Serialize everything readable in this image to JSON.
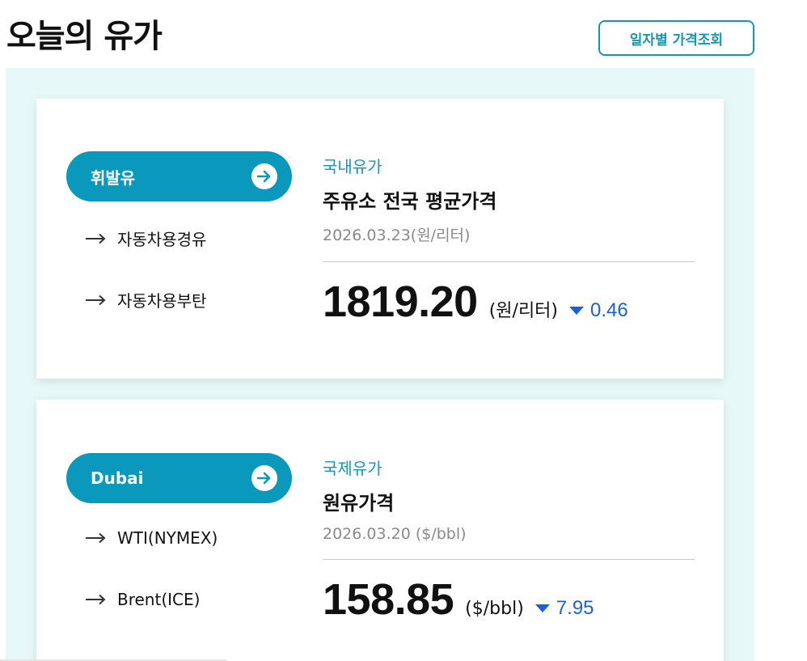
{
  "header": {
    "title": "오늘의 유가",
    "date_button_label": "일자별 가격조회"
  },
  "cards": [
    {
      "pill_label": "휘발유",
      "sub_links": [
        "자동차용경유",
        "자동차용부탄"
      ],
      "category": "국내유가",
      "heading": "주유소 전국 평균가격",
      "date": "2026.03.23(원/리터)",
      "price": "1819.20",
      "unit": "(원/리터)",
      "change": "0.46",
      "change_direction": "down"
    },
    {
      "pill_label": "Dubai",
      "sub_links": [
        "WTI(NYMEX)",
        "Brent(ICE)"
      ],
      "category": "국제유가",
      "heading": "원유가격",
      "date": "2026.03.20 ($/bbl)",
      "price": "158.85",
      "unit": "($/bbl)",
      "change": "7.95",
      "change_direction": "down"
    }
  ],
  "colors": {
    "accent": "#0a98bd",
    "panel_bg": "#e6f8f7",
    "down": "#1b5fe0"
  },
  "icons": {
    "pill_icon": "arrow-right-circle-icon",
    "link_icon": "arrow-right-icon",
    "change_icon": "triangle-down-icon"
  }
}
